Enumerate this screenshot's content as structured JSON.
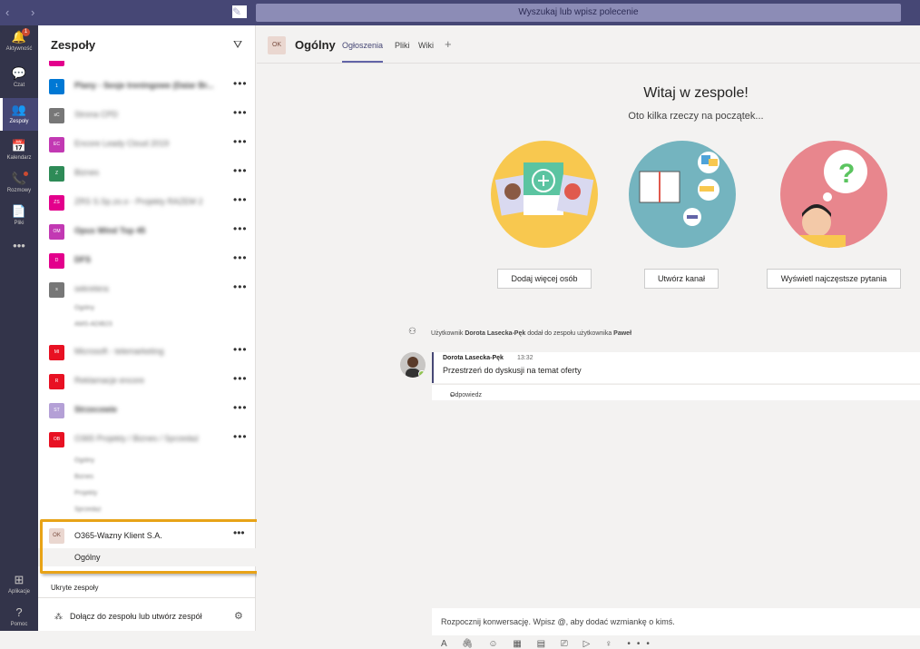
{
  "topbar": {
    "search_placeholder": "Wyszukaj lub wpisz polecenie",
    "nav": "‹ ›",
    "compose_icon": "✎"
  },
  "rail": [
    {
      "label": "Aktywność",
      "icon": "🔔",
      "badge": "1"
    },
    {
      "label": "Czat",
      "icon": "💬"
    },
    {
      "label": "Zespoły",
      "icon": "👥",
      "active": true
    },
    {
      "label": "Kalendarz",
      "icon": "📅"
    },
    {
      "label": "Rozmowy",
      "icon": "📞"
    },
    {
      "label": "Pliki",
      "icon": "📄"
    },
    {
      "label": "",
      "icon": "•••"
    }
  ],
  "rail_bottom": [
    {
      "label": "Aplikacje",
      "icon": "⊞"
    },
    {
      "label": "Pomoc",
      "icon": "?"
    }
  ],
  "panel": {
    "title": "Zespoły",
    "teams": [
      {
        "abbr": "1",
        "color": "#0078d4",
        "name": "Plany - Sesje treningowe (Daiar Br...",
        "bold": true
      },
      {
        "abbr": "sC",
        "color": "#777777",
        "name": "Strona CPD"
      },
      {
        "abbr": "EC",
        "color": "#c239b3",
        "name": "Encore Leady Cloud 2019"
      },
      {
        "abbr": "Z",
        "color": "#2e8b57",
        "name": "Biznes"
      },
      {
        "abbr": "ZS",
        "color": "#e3008c",
        "name": "ZRS S.Sp.zo.o - Projekty RAZEM 2"
      },
      {
        "abbr": "OM",
        "color": "#c239b3",
        "name": "Opus Wind Top 45",
        "bold": true
      },
      {
        "abbr": "D",
        "color": "#e3008c",
        "name": "DFS",
        "bold": true
      },
      {
        "abbr": "s",
        "color": "#777777",
        "name": "sekretera"
      },
      {
        "abbr": "MI",
        "color": "#e81123",
        "name": "Microsoft - telemarketing"
      },
      {
        "abbr": "R",
        "color": "#e81123",
        "name": "Reklamacje encore"
      },
      {
        "abbr": "ST",
        "color": "#b4a0d6",
        "name": "Strzecowie",
        "bold": true
      },
      {
        "abbr": "OB",
        "color": "#e81123",
        "name": "O365 Projekty / Biznes / Sprzedaż"
      }
    ],
    "team_channels_s": [
      "Ogólny",
      "AMS-ADIB23"
    ],
    "team_channels_ob": [
      "Ogólny",
      "Biznes",
      "Projekty",
      "Sprzedaż"
    ],
    "selected_team": {
      "abbr": "OK",
      "name": "O365-Wazny Klient S.A.",
      "channel": "Ogólny"
    },
    "hidden_teams": "Ukryte zespoły",
    "join": "Dołącz do zespołu lub utwórz zespół",
    "more": "•••"
  },
  "main": {
    "team_abbr": "OK",
    "channel_title": "Ogólny",
    "tabs": [
      "Ogłoszenia",
      "Pliki",
      "Wiki"
    ],
    "tab_add": "+",
    "welcome": "Witaj w zespole!",
    "welcome_sub": "Oto kilka rzeczy na początek...",
    "buttons": [
      "Dodaj więcej osób",
      "Utwórz kanał",
      "Wyświetl najczęstsze pytania"
    ],
    "system_message": {
      "pre": "Użytkownik ",
      "user": "Dorota Lasecka-Pęk",
      "mid": " dodał do zespołu użytkownika ",
      "target": "Paweł"
    },
    "post": {
      "author": "Dorota Lasecka-Pęk",
      "time": "13:32",
      "text": "Przestrzeń do dyskusji na temat oferty",
      "reply": "Odpowiedz"
    },
    "compose_placeholder": "Rozpocznij konwersację. Wpisz @, aby dodać wzmiankę o kimś.",
    "toolbar": "A 🖇 ☺ ▦ ▤ ⎚ ▷ ♀ •••"
  },
  "colors": {
    "accent": "#6264a7",
    "rail": "#33344a",
    "highlight": "#e8a317"
  }
}
